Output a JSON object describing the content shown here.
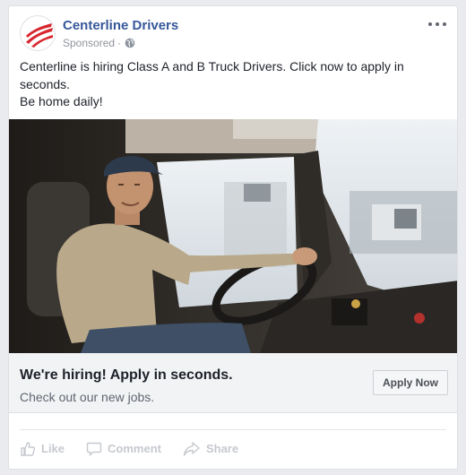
{
  "post": {
    "page_name": "Centerline Drivers",
    "sponsored_label": "Sponsored",
    "separator": "·",
    "text_lines": [
      "Centerline is hiring Class A and B Truck Drivers. Click now to apply in seconds.",
      "Be home daily!"
    ]
  },
  "link_preview": {
    "headline": "We're hiring! Apply in seconds.",
    "description": "Check out our new jobs.",
    "cta_label": "Apply Now"
  },
  "actions": {
    "like": "Like",
    "comment": "Comment",
    "share": "Share"
  },
  "icons": {
    "avatar_logo": "centerline-logo",
    "privacy": "globe-icon",
    "menu": "more-options-icon",
    "like": "thumbs-up-icon",
    "comment": "comment-bubble-icon",
    "share": "share-arrow-icon"
  },
  "colors": {
    "brand_link": "#365899",
    "logo_red": "#d7262e",
    "muted_action": "#c6c9cf"
  }
}
